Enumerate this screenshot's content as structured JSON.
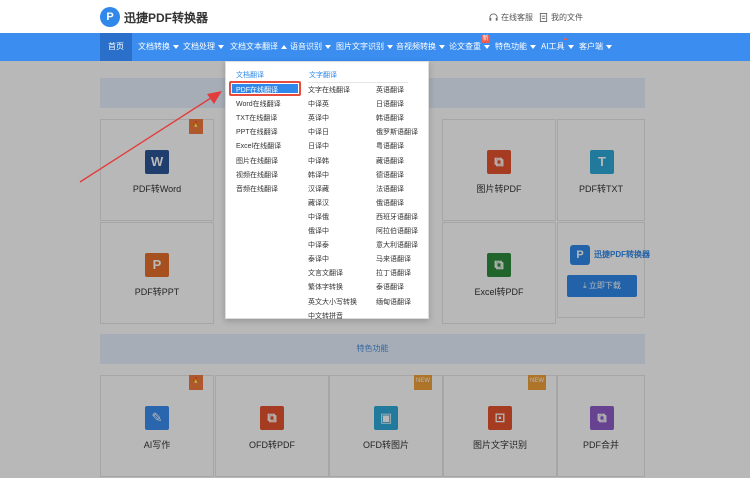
{
  "header": {
    "logo_mark": "P",
    "logo_text": "迅捷PDF转换器",
    "service_label": "在线客服",
    "files_label": "我的文件"
  },
  "nav": {
    "items": [
      {
        "label": "首页",
        "active": true
      },
      {
        "label": "文档转换",
        "caret": "down"
      },
      {
        "label": "文档处理",
        "caret": "down"
      },
      {
        "label": "文档文本翻译",
        "caret": "up"
      },
      {
        "label": "语音识别",
        "caret": "down"
      },
      {
        "label": "图片文字识别",
        "caret": "down"
      },
      {
        "label": "音视频转换",
        "caret": "down"
      },
      {
        "label": "论文查重",
        "caret": "down",
        "badge": "新"
      },
      {
        "label": "特色功能",
        "caret": "down"
      },
      {
        "label": "AI工具",
        "caret": "down",
        "badge": "▲"
      },
      {
        "label": "客户端",
        "caret": "down"
      }
    ]
  },
  "dropdown": {
    "col1_title": "文档翻译",
    "col2_title": "文字翻译",
    "col1_items": [
      "PDF在线翻译",
      "Word在线翻译",
      "TXT在线翻译",
      "PPT在线翻译",
      "Excel在线翻译",
      "图片在线翻译",
      "视频在线翻译",
      "音频在线翻译"
    ],
    "col2_items": [
      "文字在线翻译",
      "中译英",
      "英译中",
      "中译日",
      "日译中",
      "中译韩",
      "韩译中",
      "汉译藏",
      "藏译汉",
      "中译俄",
      "俄译中",
      "中译泰",
      "泰译中",
      "文言文翻译",
      "繁体字转换",
      "英文大小写转换",
      "中文转拼音"
    ],
    "col3_items": [
      "英语翻译",
      "日语翻译",
      "韩语翻译",
      "俄罗斯语翻译",
      "粤语翻译",
      "藏语翻译",
      "德语翻译",
      "法语翻译",
      "俄语翻译",
      "西班牙语翻译",
      "阿拉伯语翻译",
      "意大利语翻译",
      "马来语翻译",
      "拉丁语翻译",
      "泰语翻译",
      "缅甸语翻译"
    ]
  },
  "cards_row1": [
    {
      "label": "PDF转Word",
      "icon": "word-icon",
      "glyph": "W",
      "color": "#2b5797",
      "ribbon": "hot"
    },
    {
      "label": "图片转PDF",
      "icon": "pdf-icon",
      "glyph": "⧉",
      "color": "#e5532d"
    },
    {
      "label": "PDF转TXT",
      "icon": "txt-icon",
      "glyph": "T",
      "color": "#2fa8d8"
    }
  ],
  "cards_row2": [
    {
      "label": "PDF转PPT",
      "icon": "ppt-icon",
      "glyph": "P",
      "color": "#e7702b"
    },
    {
      "label": "Excel转PDF",
      "icon": "excel-icon",
      "glyph": "⧉",
      "color": "#2e8b3d"
    }
  ],
  "promo": {
    "logo_mark": "P",
    "title": "迅捷PDF转换器",
    "button": "⤓ 立即下载"
  },
  "feature_bar": "特色功能",
  "cards_row3": [
    {
      "label": "AI写作",
      "icon": "pen-icon",
      "glyph": "✎",
      "color": "#3b8ef0",
      "ribbon": "hot"
    },
    {
      "label": "OFD转PDF",
      "icon": "pdf-icon",
      "glyph": "⧉",
      "color": "#e5532d"
    },
    {
      "label": "OFD转图片",
      "icon": "image-icon",
      "glyph": "▣",
      "color": "#2fa8d8",
      "ribbon": "NEW"
    },
    {
      "label": "图片文字识别",
      "icon": "scan-icon",
      "glyph": "⊡",
      "color": "#e5532d",
      "ribbon": "NEW"
    },
    {
      "label": "PDF合并",
      "icon": "merge-icon",
      "glyph": "⧉",
      "color": "#8e5cc8"
    }
  ],
  "colors": {
    "nav": "#3b8ef0",
    "accent": "#2f88ea",
    "highlight": "#e74c3c"
  }
}
